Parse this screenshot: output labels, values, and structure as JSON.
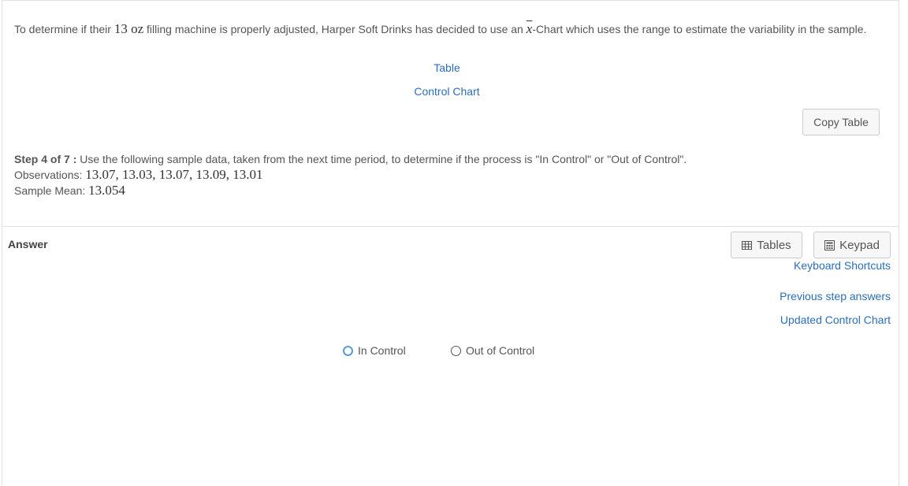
{
  "question": {
    "intro_before": "To determine if their",
    "amount": "13 oz",
    "intro_middle": "filling machine is properly adjusted, Harper Soft Drinks has decided to use an",
    "chart_symbol": "x",
    "intro_after": "-Chart which uses the range to estimate the variability in the sample.",
    "link_table": "Table",
    "link_control_chart": "Control Chart",
    "copy_table_label": "Copy Table",
    "step_label": "Step 4 of 7 :",
    "step_text": "Use the following sample data, taken from the next time period, to determine if the process is \"In Control\" or \"Out of Control\".",
    "observations_label": "Observations:",
    "observations_value": "13.07, 13.03, 13.07, 13.09, 13.01",
    "mean_label": "Sample Mean:",
    "mean_value": "13.054"
  },
  "answer": {
    "label": "Answer",
    "tables_button": "Tables",
    "keypad_button": "Keypad",
    "keyboard_shortcuts": "Keyboard Shortcuts",
    "previous_step_answers": "Previous step answers",
    "updated_control_chart": "Updated Control Chart",
    "options": [
      "In Control",
      "Out of Control"
    ],
    "selected": null
  }
}
